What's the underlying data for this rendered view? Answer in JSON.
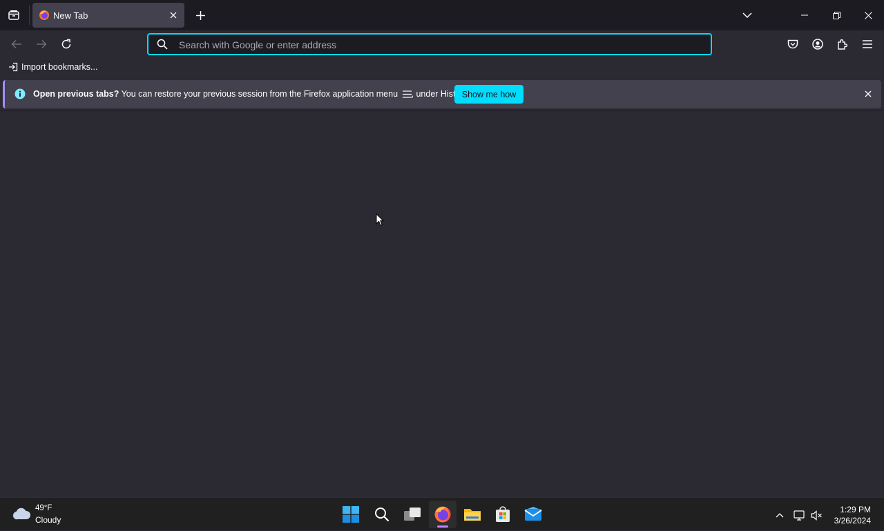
{
  "browser": {
    "tab": {
      "title": "New Tab"
    },
    "urlbar": {
      "placeholder": "Search with Google or enter address",
      "value": ""
    },
    "bookmarks": {
      "import_label": "Import bookmarks..."
    },
    "notification": {
      "title": "Open previous tabs?",
      "message_before_icon": "You can restore your previous session from the Firefox application menu",
      "message_after_icon": ", under History.",
      "button_label": "Show me how"
    }
  },
  "taskbar": {
    "weather": {
      "temperature": "49°F",
      "condition": "Cloudy"
    },
    "clock": {
      "time": "1:29 PM",
      "date": "3/26/2024"
    },
    "apps": [
      "start-icon",
      "search-icon",
      "task-view-icon",
      "firefox-icon",
      "file-explorer-icon",
      "microsoft-store-icon",
      "mail-icon"
    ]
  },
  "colors": {
    "accent": "#00ddff",
    "toolbar": "#2b2a33",
    "titlebar": "#1c1b22",
    "notification": "#42414d"
  }
}
